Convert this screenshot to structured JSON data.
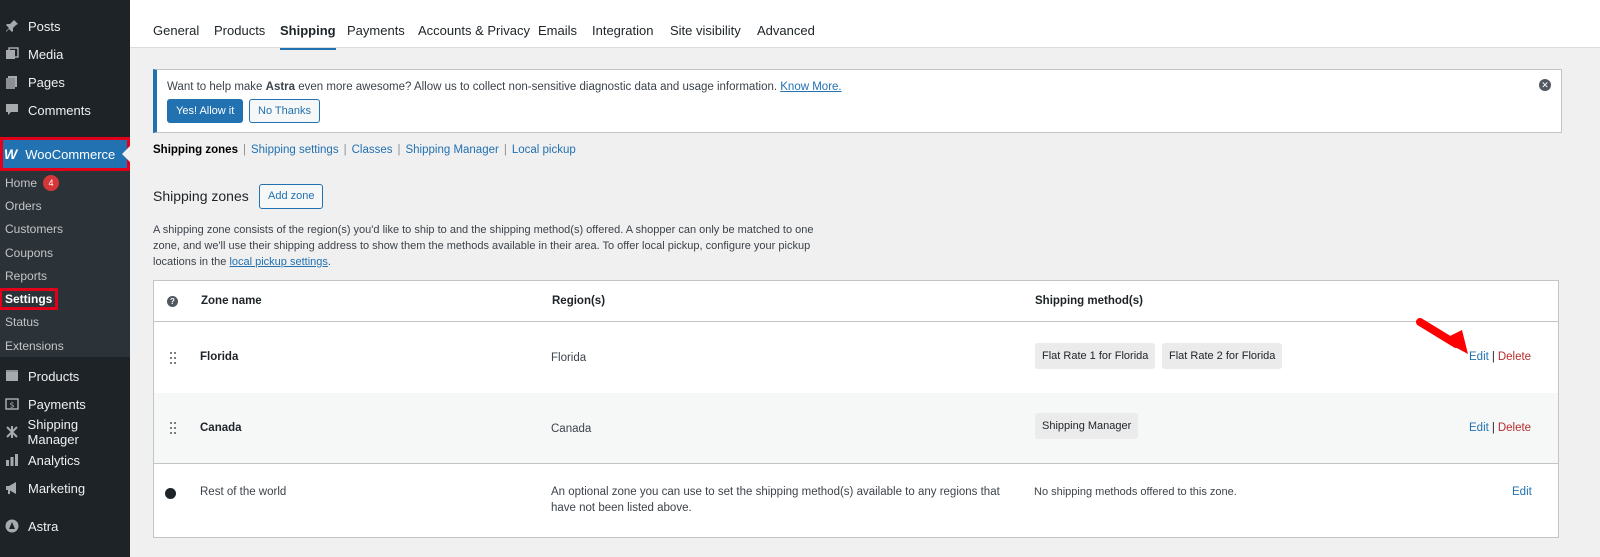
{
  "sidebar": {
    "items_top": [
      {
        "label": "Posts",
        "icon": "pin-icon"
      },
      {
        "label": "Media",
        "icon": "media-icon"
      },
      {
        "label": "Pages",
        "icon": "pages-icon"
      },
      {
        "label": "Comments",
        "icon": "comment-icon"
      }
    ],
    "woocommerce_label": "WooCommerce",
    "submenu": [
      {
        "label": "Home",
        "badge": "4"
      },
      {
        "label": "Orders"
      },
      {
        "label": "Customers"
      },
      {
        "label": "Coupons"
      },
      {
        "label": "Reports"
      },
      {
        "label": "Settings"
      },
      {
        "label": "Status"
      },
      {
        "label": "Extensions"
      }
    ],
    "items_bottom": [
      {
        "label": "Products",
        "icon": "products-icon"
      },
      {
        "label": "Payments",
        "icon": "payments-icon"
      },
      {
        "label": "Shipping Manager",
        "icon": "airplane-icon"
      },
      {
        "label": "Analytics",
        "icon": "chart-icon"
      },
      {
        "label": "Marketing",
        "icon": "megaphone-icon"
      },
      {
        "label": "Astra",
        "icon": "astra-icon"
      }
    ]
  },
  "tabs": [
    "General",
    "Products",
    "Shipping",
    "Payments",
    "Accounts & Privacy",
    "Emails",
    "Integration",
    "Site visibility",
    "Advanced"
  ],
  "notice": {
    "text_before": "Want to help make ",
    "brand": "Astra",
    "text_after": " even more awesome? Allow us to collect non-sensitive diagnostic data and usage information. ",
    "link": "Know More.",
    "allow_button": "Yes! Allow it",
    "decline_button": "No Thanks",
    "close_glyph": "✕"
  },
  "subsub": {
    "current": "Shipping zones",
    "links": [
      "Shipping settings",
      "Classes",
      "Shipping Manager",
      "Local pickup"
    ],
    "separator": "|"
  },
  "zones": {
    "title": "Shipping zones",
    "add_button": "Add zone",
    "description_before": "A shipping zone consists of the region(s) you'd like to ship to and the shipping method(s) offered. A shopper can only be matched to one zone, and we'll use their shipping address to show them the methods available in their area. To offer local pickup, configure your pickup locations in the ",
    "description_link": "local pickup settings",
    "description_after": ".",
    "headers": {
      "help": "?",
      "zone_name": "Zone name",
      "regions": "Region(s)",
      "methods": "Shipping method(s)"
    },
    "rows": [
      {
        "name": "Florida",
        "region": "Florida",
        "methods": [
          "Flat Rate 1 for Florida",
          "Flat Rate 2 for Florida"
        ],
        "edit": "Edit",
        "delete": "Delete"
      },
      {
        "name": "Canada",
        "region": "Canada",
        "methods": [
          "Shipping Manager"
        ],
        "edit": "Edit",
        "delete": "Delete"
      }
    ],
    "rest": {
      "name": "Rest of the world",
      "region_line1": "An optional zone you can use to set the shipping method(s) available to any regions that",
      "region_line2": "have not been listed above.",
      "methods": "No shipping methods offered to this zone.",
      "edit": "Edit"
    },
    "action_separator": "|"
  },
  "colors": {
    "accent": "#2271b1",
    "sidebar": "#1d2327",
    "highlight": "#e3001b",
    "delete": "#b32d2e"
  }
}
